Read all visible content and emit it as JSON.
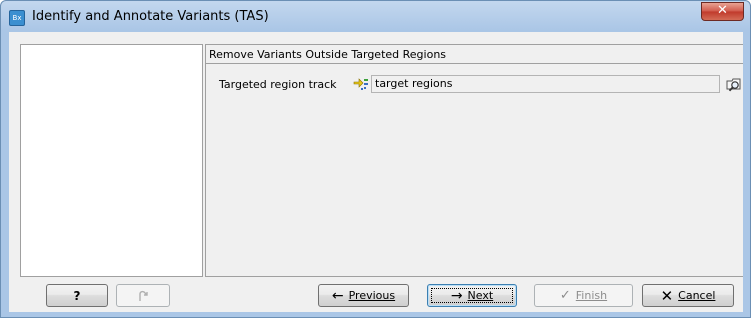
{
  "window": {
    "title": "Identify and Annotate Variants (TAS)",
    "app_icon": "Bx",
    "close_glyph": "✕"
  },
  "wizard": {
    "section_title": "Remove Variants Outside Targeted Regions",
    "field_label": "Targeted region track",
    "field_value": "target regions",
    "icons": {
      "track": "track-input-icon",
      "browse": "browse-folder-icon"
    }
  },
  "buttons": {
    "help": "?",
    "previous": "Previous",
    "next": "Next",
    "finish": "Finish",
    "cancel": "Cancel"
  },
  "colors": {
    "title_gradient": "#aac6e6",
    "close_red": "#c0392b",
    "dialog_bg": "#f0f0f0",
    "default_button_border": "#3c7fb1"
  }
}
